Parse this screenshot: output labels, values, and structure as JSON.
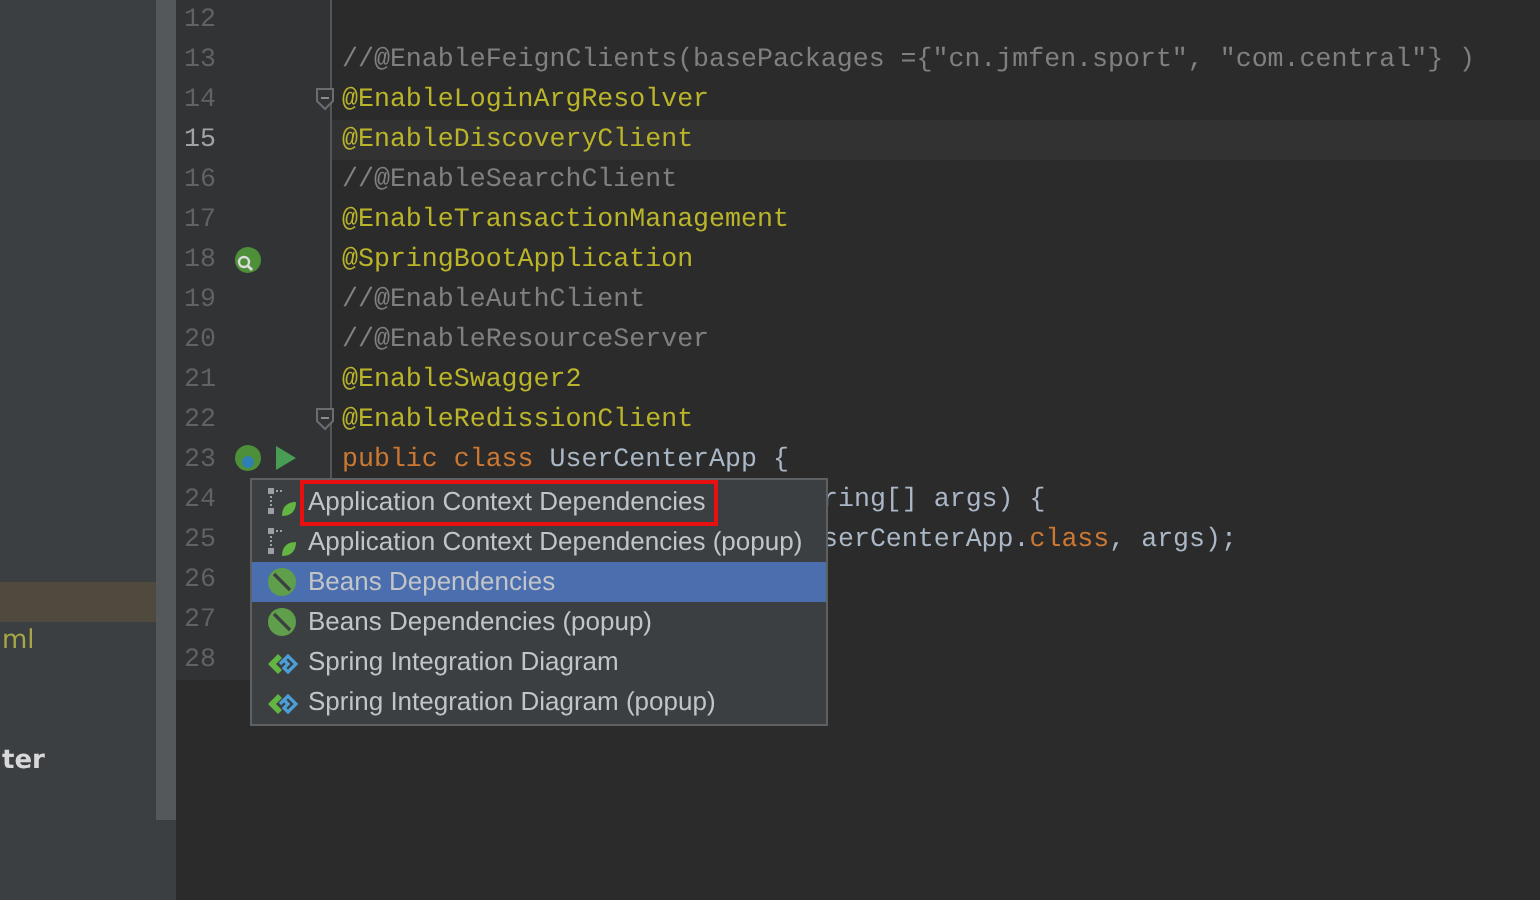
{
  "sidebar": {
    "items": [
      {
        "label": "ml",
        "kind": "file"
      },
      {
        "label": "ter",
        "kind": "heading"
      }
    ]
  },
  "editor": {
    "lines": [
      {
        "number": "12",
        "current": false,
        "kind": "plain"
      },
      {
        "number": "13",
        "current": false,
        "kind": "plain",
        "tokens": [
          {
            "kind": "comment",
            "text": "//@EnableFeignClients(basePackages ={\"cn.jmfen.sport\", \"com.central\"} )"
          }
        ]
      },
      {
        "number": "14",
        "current": false,
        "kind": "fold",
        "tokens": [
          {
            "kind": "annotation",
            "text": "@EnableLoginArgResolver"
          }
        ]
      },
      {
        "number": "15",
        "current": true,
        "kind": "plain",
        "tokens": [
          {
            "kind": "annotation",
            "text": "@EnableDiscoveryClient"
          }
        ]
      },
      {
        "number": "16",
        "current": false,
        "kind": "plain",
        "tokens": [
          {
            "kind": "comment",
            "text": "//@EnableSearchClient"
          }
        ]
      },
      {
        "number": "17",
        "current": false,
        "kind": "plain",
        "tokens": [
          {
            "kind": "annotation",
            "text": "@EnableTransactionManagement"
          }
        ]
      },
      {
        "number": "18",
        "current": false,
        "kind": "bean",
        "tokens": [
          {
            "kind": "annotation",
            "text": "@SpringBootApplication"
          }
        ]
      },
      {
        "number": "19",
        "current": false,
        "kind": "plain",
        "tokens": [
          {
            "kind": "comment",
            "text": "//@EnableAuthClient"
          }
        ]
      },
      {
        "number": "20",
        "current": false,
        "kind": "plain",
        "tokens": [
          {
            "kind": "comment",
            "text": "//@EnableResourceServer"
          }
        ]
      },
      {
        "number": "21",
        "current": false,
        "kind": "plain",
        "tokens": [
          {
            "kind": "annotation",
            "text": "@EnableSwagger2"
          }
        ]
      },
      {
        "number": "22",
        "current": false,
        "kind": "fold",
        "tokens": [
          {
            "kind": "annotation",
            "text": "@EnableRedissionClient"
          }
        ]
      },
      {
        "number": "23",
        "current": false,
        "kind": "class",
        "tokens": [
          {
            "kind": "keyword",
            "text": "public class "
          },
          {
            "kind": "plain",
            "text": "UserCenterApp {"
          }
        ]
      },
      {
        "number": "24",
        "current": false,
        "kind": "behind",
        "tokens": [
          {
            "kind": "plain",
            "text": "ring[] args) {"
          }
        ]
      },
      {
        "number": "25",
        "current": false,
        "kind": "behind",
        "tokens": [
          {
            "kind": "plain",
            "text": "serCenterApp."
          },
          {
            "kind": "keyword",
            "text": "class"
          },
          {
            "kind": "plain",
            "text": ", args);"
          }
        ]
      },
      {
        "number": "26",
        "current": false,
        "kind": "plain"
      },
      {
        "number": "27",
        "current": false,
        "kind": "plain"
      },
      {
        "number": "28",
        "current": false,
        "kind": "plain"
      }
    ]
  },
  "popup": {
    "items": [
      {
        "label": "Application Context Dependencies",
        "kind": "context",
        "selected": false,
        "annotated": true
      },
      {
        "label": "Application Context Dependencies (popup)",
        "kind": "context",
        "selected": false,
        "annotated": false
      },
      {
        "label": "Beans Dependencies",
        "kind": "bean",
        "selected": true,
        "annotated": false
      },
      {
        "label": "Beans Dependencies (popup)",
        "kind": "bean",
        "selected": false,
        "annotated": false
      },
      {
        "label": "Spring Integration Diagram",
        "kind": "integration",
        "selected": false,
        "annotated": false
      },
      {
        "label": "Spring Integration Diagram (popup)",
        "kind": "integration",
        "selected": false,
        "annotated": false
      }
    ]
  }
}
